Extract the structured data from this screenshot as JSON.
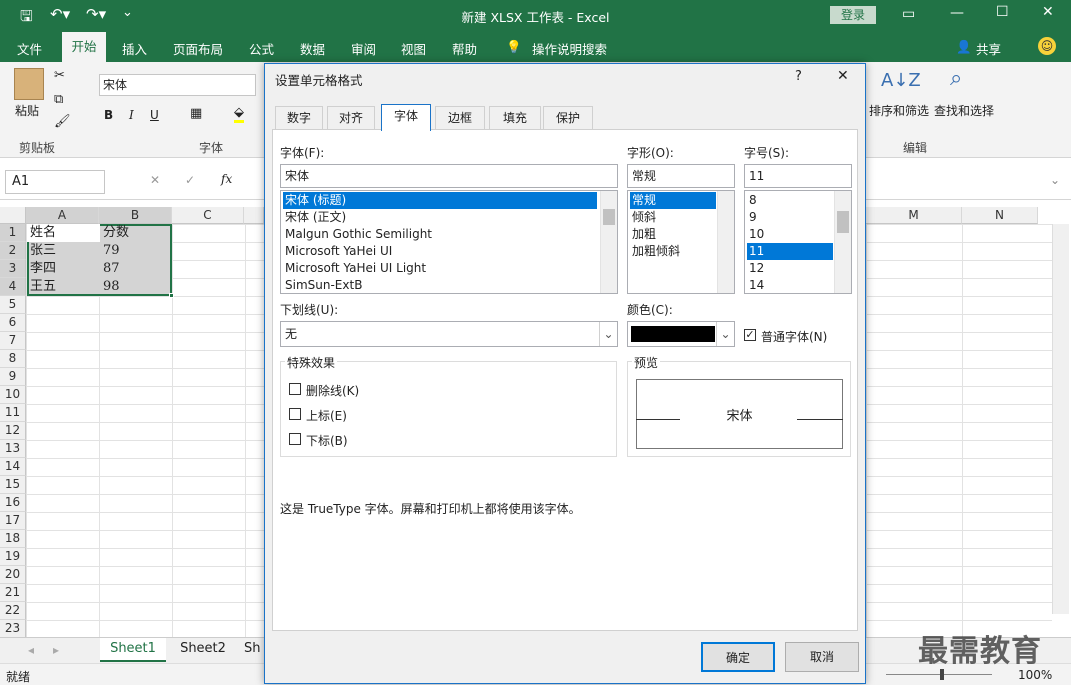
{
  "app": {
    "title": "新建 XLSX 工作表 - Excel",
    "login": "登录"
  },
  "tabs": [
    "文件",
    "开始",
    "插入",
    "页面布局",
    "公式",
    "数据",
    "审阅",
    "视图",
    "帮助",
    "操作说明搜索"
  ],
  "share": "共享",
  "ribbon": {
    "paste": "粘贴",
    "clipboard": "剪贴板",
    "font_group": "字体",
    "font_name": "宋体",
    "bold": "B",
    "italic": "I",
    "underline": "U",
    "sort": "排序和筛选",
    "find": "查找和选择",
    "edit": "编辑"
  },
  "formula": {
    "namebox": "A1",
    "fx": "fx"
  },
  "columns": [
    "A",
    "B",
    "C",
    "M",
    "N"
  ],
  "rows": [
    "1",
    "2",
    "3",
    "4",
    "5",
    "6",
    "7",
    "8",
    "9",
    "10",
    "11",
    "12",
    "13",
    "14",
    "15",
    "16",
    "17",
    "18",
    "19",
    "20",
    "21",
    "22",
    "23"
  ],
  "cells": [
    [
      "姓名",
      "分数"
    ],
    [
      "张三",
      "79"
    ],
    [
      "李四",
      "87"
    ],
    [
      "王五",
      "98"
    ]
  ],
  "sheets": [
    "Sheet1",
    "Sheet2",
    "Sh"
  ],
  "status": {
    "ready": "就绪",
    "zoom": "100%"
  },
  "watermark": "最需教育",
  "dialog": {
    "title": "设置单元格格式",
    "help": "?",
    "close": "✕",
    "tabs": [
      "数字",
      "对齐",
      "字体",
      "边框",
      "填充",
      "保护"
    ],
    "font_label": "字体(F):",
    "font_value": "宋体",
    "fonts": [
      "宋体 (标题)",
      "宋体 (正文)",
      "Malgun Gothic Semilight",
      "Microsoft YaHei UI",
      "Microsoft YaHei UI Light",
      "SimSun-ExtB"
    ],
    "style_label": "字形(O):",
    "style_value": "常规",
    "styles": [
      "常规",
      "倾斜",
      "加粗",
      "加粗倾斜"
    ],
    "size_label": "字号(S):",
    "size_value": "11",
    "sizes": [
      "8",
      "9",
      "10",
      "11",
      "12",
      "14"
    ],
    "underline_label": "下划线(U):",
    "underline_value": "无",
    "color_label": "颜色(C):",
    "color_value": "#000000",
    "normal_font": "普通字体(N)",
    "effects_label": "特殊效果",
    "strike": "删除线(K)",
    "sup": "上标(E)",
    "sub": "下标(B)",
    "preview_label": "预览",
    "preview_text": "宋体",
    "info": "这是 TrueType 字体。屏幕和打印机上都将使用该字体。",
    "ok": "确定",
    "cancel": "取消"
  },
  "colors": {
    "excel_green": "#217346",
    "accent": "#0078d7"
  }
}
